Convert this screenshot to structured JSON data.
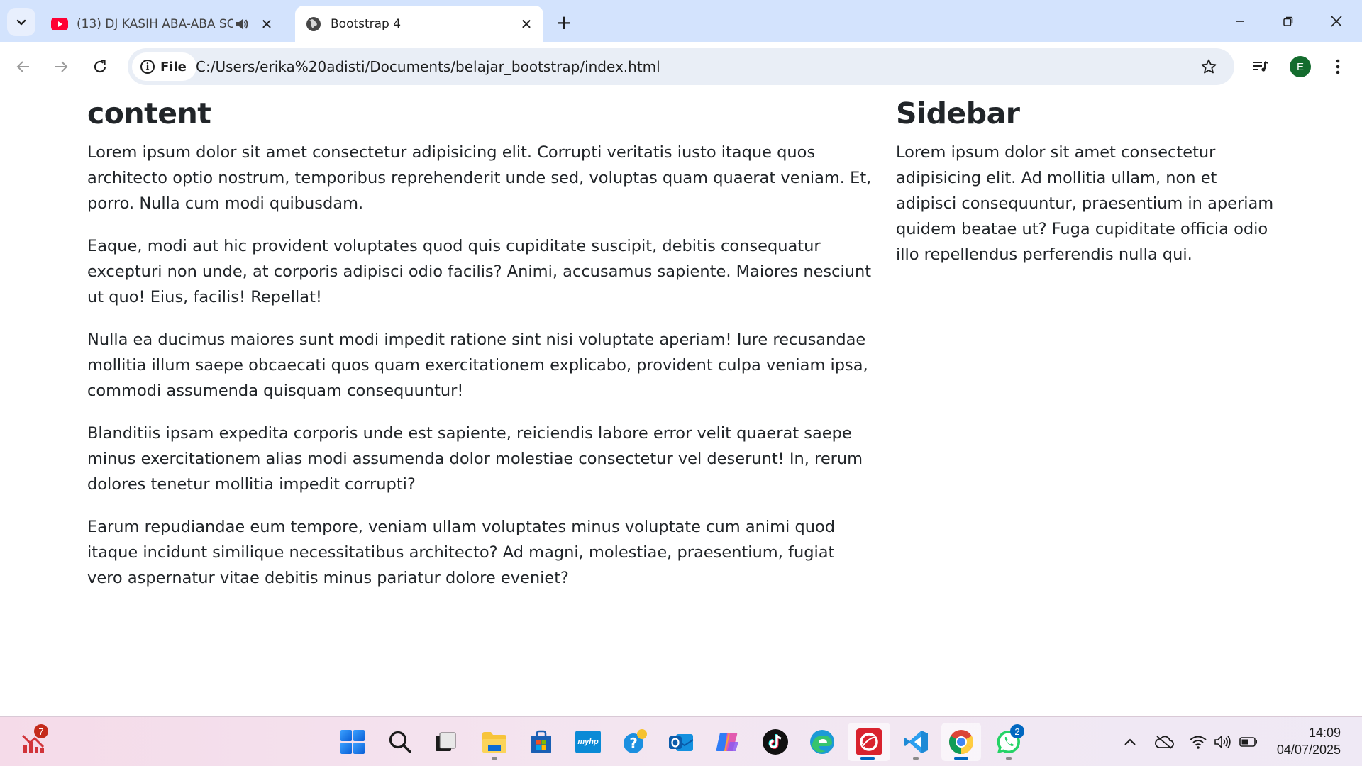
{
  "browser": {
    "tabs": [
      {
        "title": "(13) DJ KASIH ABA-ABA SO",
        "favicon": "youtube-icon",
        "audio": true,
        "active": false
      },
      {
        "title": "Bootstrap 4",
        "favicon": "globe-icon",
        "audio": false,
        "active": true
      }
    ],
    "address": {
      "chip_label": "File",
      "url": "C:/Users/erika%20adisti/Documents/belajar_bootstrap/index.html"
    },
    "profile_initial": "E"
  },
  "page": {
    "main": {
      "heading": "content",
      "paragraphs": [
        "Lorem ipsum dolor sit amet consectetur adipisicing elit. Corrupti veritatis iusto itaque quos architecto optio nostrum, temporibus reprehenderit unde sed, voluptas quam quaerat veniam. Et, porro. Nulla cum modi quibusdam.",
        "Eaque, modi aut hic provident voluptates quod quis cupiditate suscipit, debitis consequatur excepturi non unde, at corporis adipisci odio facilis? Animi, accusamus sapiente. Maiores nesciunt ut quo! Eius, facilis! Repellat!",
        "Nulla ea ducimus maiores sunt modi impedit ratione sint nisi voluptate aperiam! Iure recusandae mollitia illum saepe obcaecati quos quam exercitationem explicabo, provident culpa veniam ipsa, commodi assumenda quisquam consequuntur!",
        "Blanditiis ipsam expedita corporis unde est sapiente, reiciendis labore error velit quaerat saepe minus exercitationem alias modi assumenda dolor molestiae consectetur vel deserunt! In, rerum dolores tenetur mollitia impedit corrupti?",
        "Earum repudiandae eum tempore, veniam ullam voluptates minus voluptate cum animi quod itaque incidunt similique necessitatibus architecto? Ad magni, molestiae, praesentium, fugiat vero aspernatur vitae debitis minus pariatur dolore eveniet?"
      ]
    },
    "sidebar": {
      "heading": "Sidebar",
      "paragraph": "Lorem ipsum dolor sit amet consectetur adipisicing elit. Ad mollitia ullam, non et adipisci consequuntur, praesentium in aperiam quidem beatae ut? Fuga cupiditate officia odio illo repellendus perferendis nulla qui."
    }
  },
  "taskbar": {
    "widget_badge": "7",
    "whatsapp_badge": "2",
    "apps": [
      "start-icon",
      "search-icon",
      "task-view-icon",
      "file-explorer-icon",
      "microsoft-store-icon",
      "myhp-icon",
      "get-help-icon",
      "outlook-icon",
      "copilot-icon",
      "tiktok-icon",
      "edge-icon",
      "antivirus-icon",
      "vscode-icon",
      "chrome-icon",
      "whatsapp-icon"
    ],
    "myhp_label": "myhp",
    "time": "14:09",
    "date": "04/07/2025"
  },
  "colors": {
    "tabstrip": "#d3e3fd",
    "omnibox": "#e9eef6",
    "text": "#212529",
    "accent": "#0067c0"
  }
}
